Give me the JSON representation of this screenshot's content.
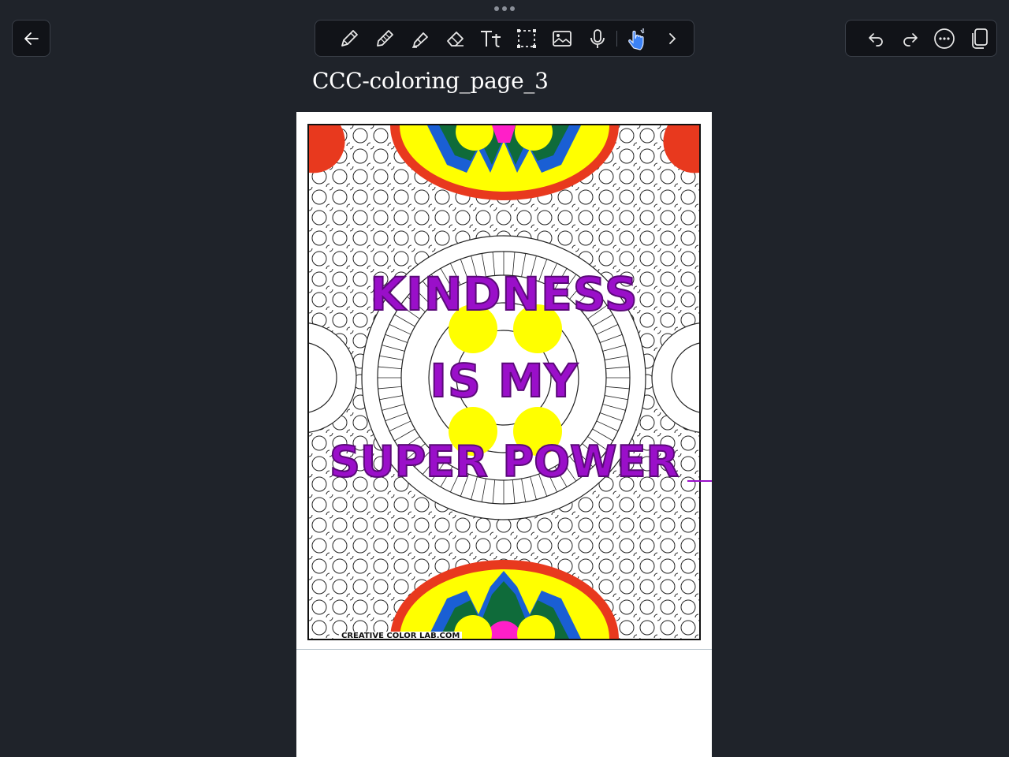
{
  "toolbar": {
    "tools": [
      {
        "name": "pen-icon"
      },
      {
        "name": "pencil-icon"
      },
      {
        "name": "highlighter-icon"
      },
      {
        "name": "eraser-icon"
      },
      {
        "name": "text-icon",
        "label": "Tt"
      },
      {
        "name": "lasso-selection-icon"
      },
      {
        "name": "image-icon"
      },
      {
        "name": "microphone-icon"
      },
      {
        "name": "touch-gesture-icon"
      },
      {
        "name": "chevron-right-icon"
      }
    ],
    "active_tool_color": "#3b82f6"
  },
  "actions": [
    {
      "name": "undo-icon"
    },
    {
      "name": "redo-icon"
    },
    {
      "name": "more-options-icon"
    },
    {
      "name": "duplicate-page-icon"
    }
  ],
  "document": {
    "title": "CCC-coloring_page_3"
  },
  "artwork": {
    "text_lines": [
      "KINDNESS",
      "IS MY",
      "SUPER POWER"
    ],
    "credit": "CREATIVE COLOR LAB.COM",
    "colors": {
      "purple": "#9a0fc9",
      "yellow": "#ffff00",
      "red": "#e8391e",
      "green": "#0f6b3a",
      "blue": "#1a5fd4",
      "magenta": "#ff1fc8"
    }
  }
}
